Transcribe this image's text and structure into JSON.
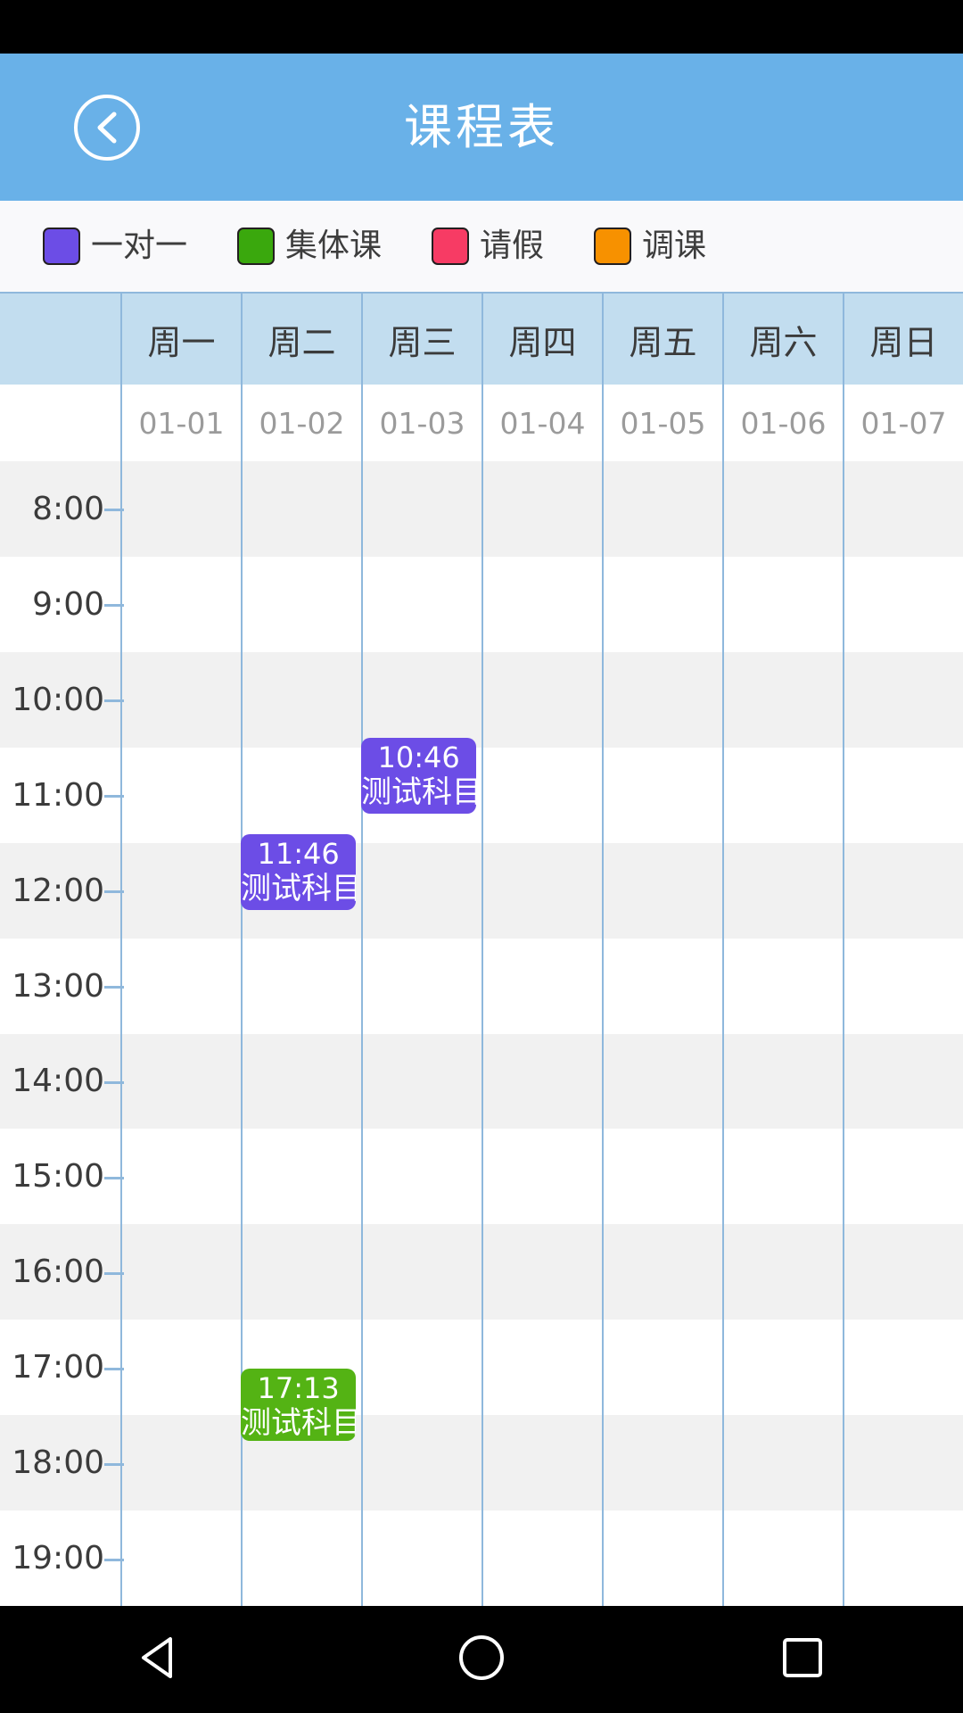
{
  "app": {
    "title": "课程表",
    "back_icon": "chevron-left-icon",
    "header_bg": "#69b1e8"
  },
  "legend": {
    "items": [
      {
        "label": "一对一",
        "color": "#6c4de6",
        "name": "one-on-one"
      },
      {
        "label": "集体课",
        "color": "#3aa80d",
        "name": "group-class"
      },
      {
        "label": "请假",
        "color": "#f73b64",
        "name": "leave"
      },
      {
        "label": "调课",
        "color": "#f79100",
        "name": "reschedule"
      }
    ]
  },
  "calendar": {
    "weekdays": [
      "周一",
      "周二",
      "周三",
      "周四",
      "周五",
      "周六",
      "周日"
    ],
    "dates": [
      "01-01",
      "01-02",
      "01-03",
      "01-04",
      "01-05",
      "01-06",
      "01-07"
    ],
    "hours": [
      "8:00",
      "9:00",
      "10:00",
      "11:00",
      "12:00",
      "13:00",
      "14:00",
      "15:00",
      "16:00",
      "17:00",
      "18:00",
      "19:00"
    ],
    "events": [
      {
        "name": "event-wed-1046",
        "day_index": 2,
        "time": "10:46",
        "title": "测试科目a",
        "color": "#6c4de6",
        "top_pct": 24.2,
        "height_pct": 6.6
      },
      {
        "name": "event-tue-1146",
        "day_index": 1,
        "time": "11:46",
        "title": "测试科目a",
        "color": "#6c4de6",
        "top_pct": 32.6,
        "height_pct": 6.6
      },
      {
        "name": "event-tue-1713",
        "day_index": 1,
        "time": "17:13",
        "title": "测试科目",
        "color": "#54b314",
        "top_pct": 79.3,
        "height_pct": 6.3
      }
    ]
  },
  "nav": {
    "buttons": [
      {
        "name": "nav-back-triangle-icon",
        "glyph": "back"
      },
      {
        "name": "nav-home-circle-icon",
        "glyph": "home"
      },
      {
        "name": "nav-recents-square-icon",
        "glyph": "recents"
      }
    ]
  }
}
